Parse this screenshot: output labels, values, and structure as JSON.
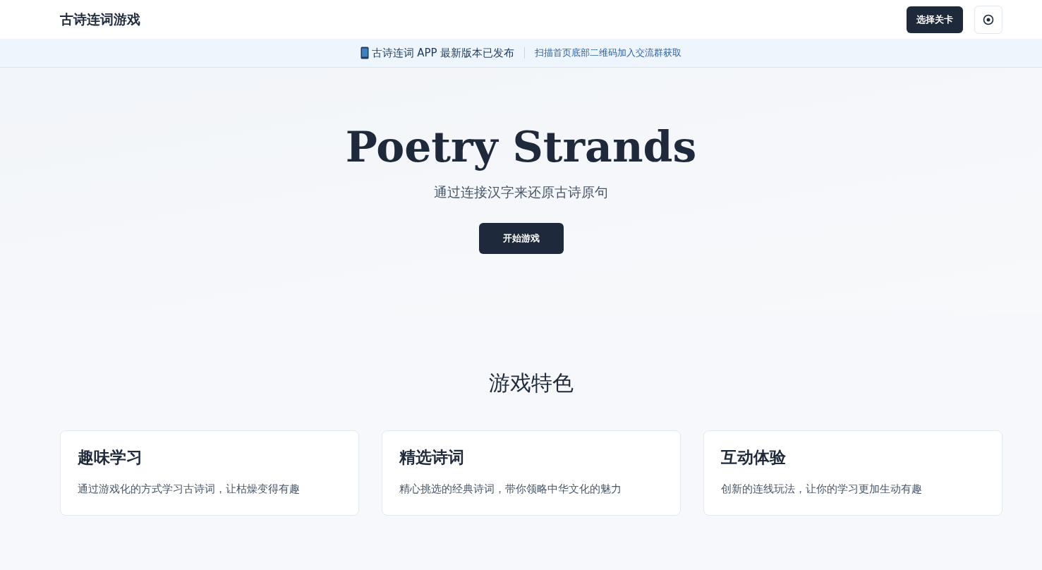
{
  "header": {
    "logo": "古诗连词游戏",
    "buttons": [
      {
        "kind": "text",
        "label": "选择关卡"
      },
      {
        "kind": "icon"
      }
    ]
  },
  "banner": {
    "text": "古诗连词 APP 最新版本已发布",
    "link": "扫描首页底部二维码加入交流群获取"
  },
  "hero": {
    "title": "Poetry Strands",
    "subtitle": "通过连接汉字来还原古诗原句",
    "button": "开始游戏"
  },
  "features": {
    "heading": "游戏特色",
    "cards": [
      {
        "title": "趣味学习",
        "text": "通过游戏化的方式学习古诗词，让枯燥变得有趣"
      },
      {
        "title": "精选诗词",
        "text": "精心挑选的经典诗词，带你领略中华文化的魅力"
      },
      {
        "title": "互动体验",
        "text": "创新的连线玩法，让你的学习更加生动有趣"
      }
    ]
  }
}
